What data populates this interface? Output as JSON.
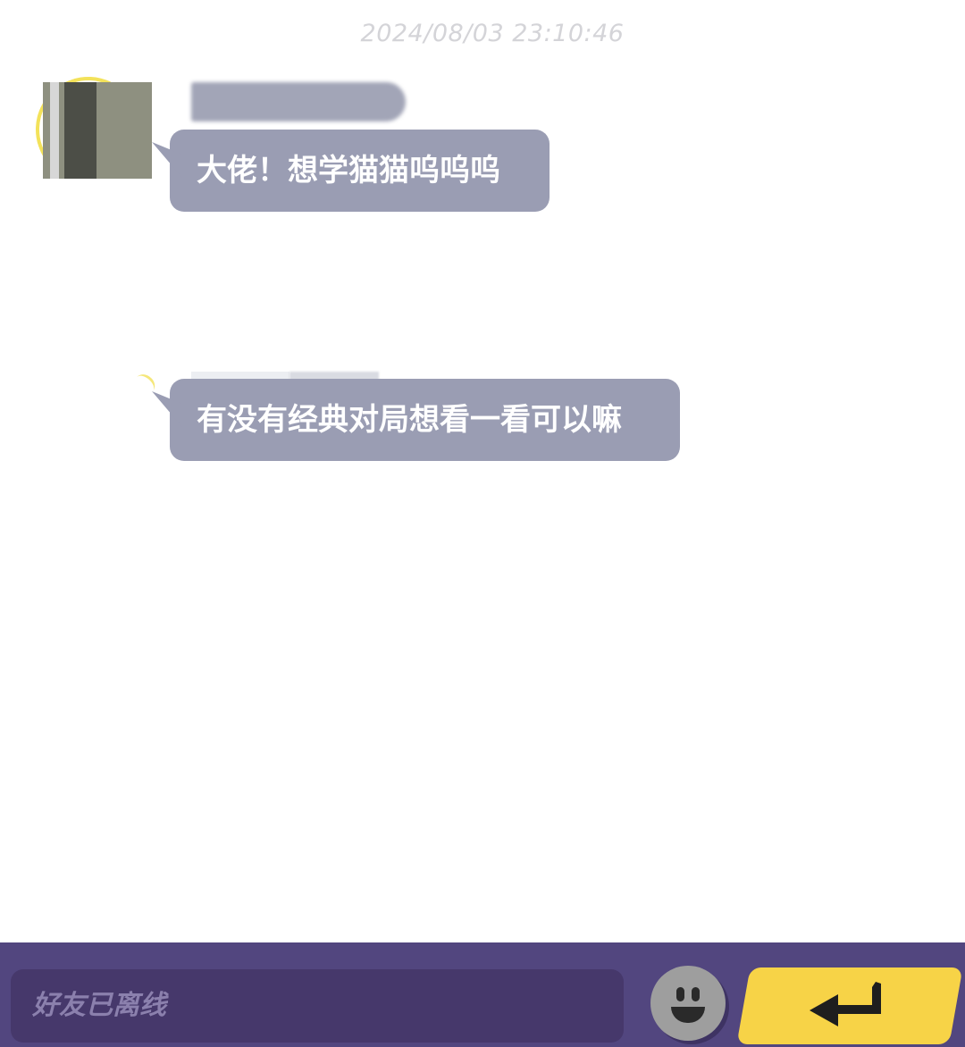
{
  "chat": {
    "timestamp": "2024/08/03 23:10:46",
    "messages": [
      {
        "text": "大佬！想学猫猫呜呜呜"
      },
      {
        "text": "有没有经典对局想看一看可以嘛"
      }
    ]
  },
  "input": {
    "placeholder": "好友已离线"
  },
  "icons": {
    "emoji": "smiley-face-icon",
    "send": "enter-return-icon"
  },
  "colors": {
    "bubble": "#9a9db3",
    "bar": "#52467f",
    "input": "#46386b",
    "send": "#f7d347"
  }
}
